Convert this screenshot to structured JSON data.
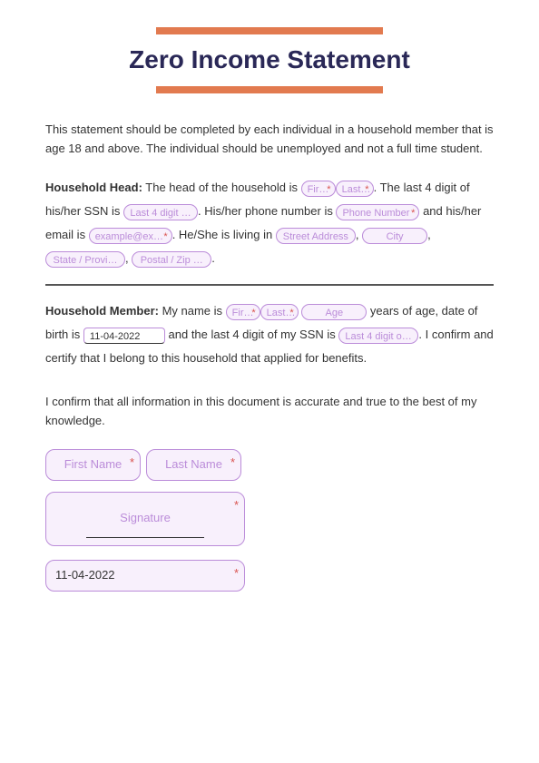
{
  "title": "Zero Income Statement",
  "intro": "This statement should be completed by each individual in a household member that is age 18 and above. The individual should be unemployed and not a full time student.",
  "householdHead": {
    "label": "Household Head:",
    "text1": " The head of the household is ",
    "firstName": "Fir…",
    "lastName": "Last…",
    "text2": ". The last 4 digit of his/her SSN is ",
    "ssn": "Last 4 digit …",
    "text3": ". His/her phone number is ",
    "phone": "Phone Number",
    "text4": " and his/her email is ",
    "email": "example@ex…",
    "text5": ". He/She is living in ",
    "street": "Street Address",
    "city": "City",
    "state": "State / Provi…",
    "postal": "Postal / Zip …"
  },
  "householdMember": {
    "label": "Household Member:",
    "text1": " My name is ",
    "firstName": "Fir…",
    "lastName": "Last…",
    "age": "Age",
    "text2": " years of age, date of birth is ",
    "dob": "11-04-2022",
    "text3": " and the last 4 digit of my SSN is ",
    "ssn": "Last 4 digit o…",
    "text4": " I confirm and certify that I belong to this household that applied for benefits."
  },
  "confirm": "I confirm that all information in this document is accurate and true to the best of my knowledge.",
  "signer": {
    "firstName": "First Name",
    "lastName": "Last Name",
    "signature": "Signature",
    "date": "11-04-2022"
  }
}
